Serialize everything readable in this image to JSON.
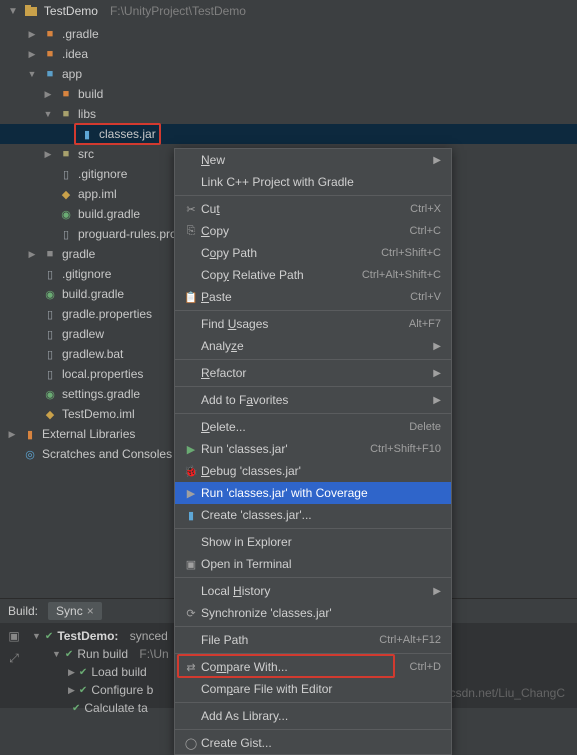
{
  "header": {
    "project_name": "TestDemo",
    "project_path": "F:\\UnityProject\\TestDemo"
  },
  "tree": {
    "gradle_folder": ".gradle",
    "idea_folder": ".idea",
    "app": "app",
    "build": "build",
    "libs": "libs",
    "classes_jar": "classes.jar",
    "src": "src",
    "gitignore": ".gitignore",
    "app_iml": "app.iml",
    "build_gradle": "build.gradle",
    "proguard": "proguard-rules.pro",
    "gradle_folder2": "gradle",
    "gitignore2": ".gitignore",
    "build_gradle2": "build.gradle",
    "gradle_properties": "gradle.properties",
    "gradlew": "gradlew",
    "gradlew_bat": "gradlew.bat",
    "local_properties": "local.properties",
    "settings_gradle": "settings.gradle",
    "testdemo_iml": "TestDemo.iml",
    "external_libs": "External Libraries",
    "scratches": "Scratches and Consoles"
  },
  "ctx": {
    "new": "New",
    "link_cpp": "Link C++ Project with Gradle",
    "cut": "Cut",
    "cut_sc": "Ctrl+X",
    "copy": "Copy",
    "copy_sc": "Ctrl+C",
    "copy_path": "Copy Path",
    "copy_path_sc": "Ctrl+Shift+C",
    "copy_rel": "Copy Relative Path",
    "copy_rel_sc": "Ctrl+Alt+Shift+C",
    "paste": "Paste",
    "paste_sc": "Ctrl+V",
    "find_usages": "Find Usages",
    "find_usages_sc": "Alt+F7",
    "analyze": "Analyze",
    "refactor": "Refactor",
    "add_fav": "Add to Favorites",
    "delete": "Delete...",
    "delete_sc": "Delete",
    "run": "Run 'classes.jar'",
    "run_sc": "Ctrl+Shift+F10",
    "debug": "Debug 'classes.jar'",
    "coverage": "Run 'classes.jar' with Coverage",
    "create": "Create 'classes.jar'...",
    "show_explorer": "Show in Explorer",
    "open_terminal": "Open in Terminal",
    "local_history": "Local History",
    "synchronize": "Synchronize 'classes.jar'",
    "file_path": "File Path",
    "file_path_sc": "Ctrl+Alt+F12",
    "compare_with": "Compare With...",
    "compare_with_sc": "Ctrl+D",
    "compare_editor": "Compare File with Editor",
    "add_as_lib": "Add As Library...",
    "create_gist": "Create Gist..."
  },
  "build": {
    "tab_build": "Build:",
    "tab_sync": "Sync",
    "testdemo": "TestDemo:",
    "synced": "synced",
    "run_build": "Run build",
    "run_path": "F:\\Un",
    "load_build": "Load build",
    "configure": "Configure b",
    "calculate": "Calculate ta"
  },
  "watermark": "https://blog.csdn.net/Liu_ChangC"
}
